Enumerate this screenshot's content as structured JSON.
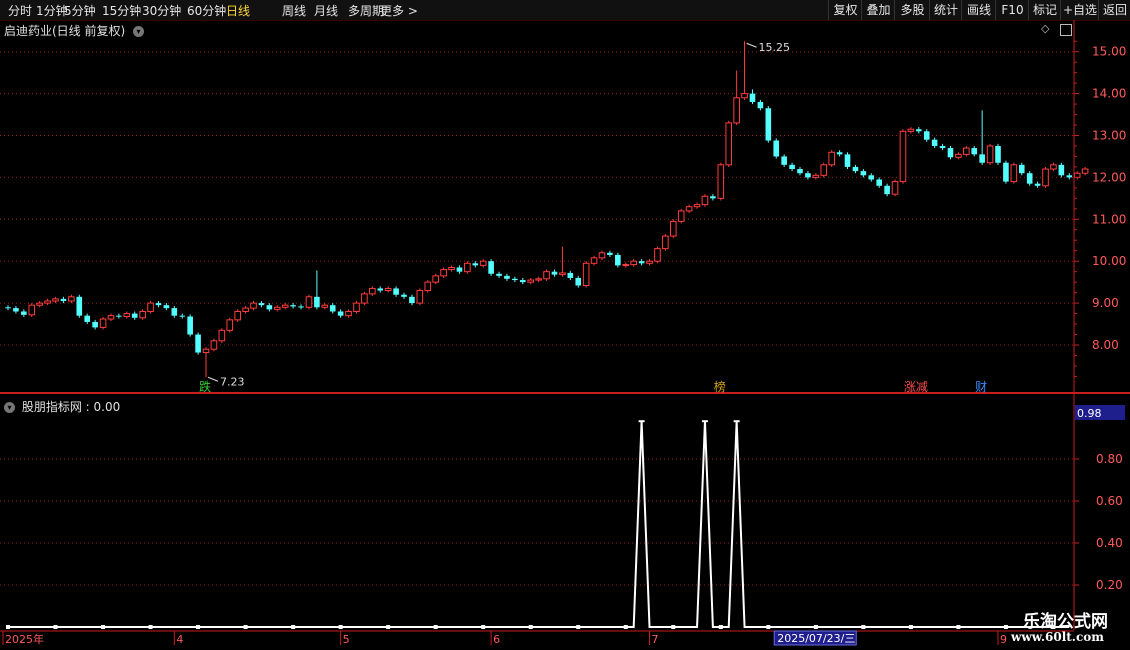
{
  "toolbar": {
    "left": [
      "分时",
      "1分钟",
      "5分钟",
      "15分钟",
      "30分钟",
      "60分钟",
      "日线",
      "周线",
      "月线",
      "多周期",
      "更多 >"
    ],
    "active": "日线",
    "right": [
      "复权",
      "叠加",
      "多股",
      "统计",
      "画线",
      "F10",
      "标记",
      "+自选",
      "返回"
    ]
  },
  "main_title": "启迪药业(日线 前复权)",
  "indicator_title": "股朋指标网 : 0.00",
  "markers": {
    "high": "15.25",
    "low": "7.23"
  },
  "events": [
    {
      "label": "跌",
      "color": "#33cc33",
      "date": "2025-04-08"
    },
    {
      "label": "榜",
      "color": "#d4a017",
      "date": "2025-07-14"
    },
    {
      "label": "涨减",
      "color": "#ff4d4d",
      "date": "2025-08-15"
    },
    {
      "label": "财",
      "color": "#3b8cff",
      "date": "2025-08-28"
    }
  ],
  "date_axis": {
    "labels": [
      {
        "date": "2025-03-03",
        "text": "2025年"
      },
      {
        "date": "2025-04-01",
        "text": "4"
      },
      {
        "date": "2025-05-06",
        "text": "5"
      },
      {
        "date": "2025-06-03",
        "text": "6"
      },
      {
        "date": "2025-07-01",
        "text": "7"
      },
      {
        "date": "2025-09-01",
        "text": "9"
      }
    ],
    "cursor_label": "2025/07/23/三"
  },
  "indicator_readout": "0.98",
  "watermark": {
    "text": "乐淘公式网",
    "url": "www.60lt.com"
  },
  "colors": {
    "up": "#ff3d3d",
    "down": "#54ffff",
    "grid": "#9a1e1e",
    "axis": "#c81e1e",
    "label": "#ff5a5a",
    "line": "#ffffff",
    "readout_bg": "#1e1e8c"
  },
  "chart_data": [
    {
      "type": "candlestick",
      "title": "启迪药业(日线 前复权)",
      "ylim": [
        7.0,
        15.3
      ],
      "yticks": [
        8.0,
        9.0,
        10.0,
        11.0,
        12.0,
        13.0,
        14.0,
        15.0
      ],
      "grid": true,
      "x": [
        "2025-03-03",
        "2025-03-04",
        "2025-03-05",
        "2025-03-06",
        "2025-03-07",
        "2025-03-10",
        "2025-03-11",
        "2025-03-12",
        "2025-03-13",
        "2025-03-14",
        "2025-03-17",
        "2025-03-18",
        "2025-03-19",
        "2025-03-20",
        "2025-03-21",
        "2025-03-24",
        "2025-03-25",
        "2025-03-26",
        "2025-03-27",
        "2025-03-28",
        "2025-03-31",
        "2025-04-01",
        "2025-04-02",
        "2025-04-03",
        "2025-04-07",
        "2025-04-08",
        "2025-04-09",
        "2025-04-10",
        "2025-04-11",
        "2025-04-14",
        "2025-04-15",
        "2025-04-16",
        "2025-04-17",
        "2025-04-18",
        "2025-04-21",
        "2025-04-22",
        "2025-04-23",
        "2025-04-24",
        "2025-04-25",
        "2025-04-28",
        "2025-04-29",
        "2025-04-30",
        "2025-05-06",
        "2025-05-07",
        "2025-05-08",
        "2025-05-09",
        "2025-05-12",
        "2025-05-13",
        "2025-05-14",
        "2025-05-15",
        "2025-05-16",
        "2025-05-19",
        "2025-05-20",
        "2025-05-21",
        "2025-05-22",
        "2025-05-23",
        "2025-05-26",
        "2025-05-27",
        "2025-05-28",
        "2025-05-29",
        "2025-05-30",
        "2025-06-03",
        "2025-06-04",
        "2025-06-05",
        "2025-06-06",
        "2025-06-09",
        "2025-06-10",
        "2025-06-11",
        "2025-06-12",
        "2025-06-13",
        "2025-06-16",
        "2025-06-17",
        "2025-06-18",
        "2025-06-19",
        "2025-06-20",
        "2025-06-23",
        "2025-06-24",
        "2025-06-25",
        "2025-06-26",
        "2025-06-27",
        "2025-06-30",
        "2025-07-01",
        "2025-07-02",
        "2025-07-03",
        "2025-07-04",
        "2025-07-07",
        "2025-07-08",
        "2025-07-09",
        "2025-07-10",
        "2025-07-11",
        "2025-07-14",
        "2025-07-15",
        "2025-07-16",
        "2025-07-17",
        "2025-07-18",
        "2025-07-21",
        "2025-07-22",
        "2025-07-23",
        "2025-07-24",
        "2025-07-25",
        "2025-07-28",
        "2025-07-29",
        "2025-07-30",
        "2025-07-31",
        "2025-08-01",
        "2025-08-04",
        "2025-08-05",
        "2025-08-06",
        "2025-08-07",
        "2025-08-08",
        "2025-08-11",
        "2025-08-12",
        "2025-08-13",
        "2025-08-14",
        "2025-08-15",
        "2025-08-18",
        "2025-08-19",
        "2025-08-20",
        "2025-08-21",
        "2025-08-22",
        "2025-08-25",
        "2025-08-26",
        "2025-08-27",
        "2025-08-28",
        "2025-08-29",
        "2025-09-01",
        "2025-09-02",
        "2025-09-03",
        "2025-09-04",
        "2025-09-05",
        "2025-09-08",
        "2025-09-09",
        "2025-09-10",
        "2025-09-11",
        "2025-09-12"
      ],
      "open": [
        8.9,
        8.88,
        8.8,
        8.72,
        8.95,
        9.0,
        9.05,
        9.1,
        9.05,
        9.15,
        8.7,
        8.55,
        8.42,
        8.62,
        8.7,
        8.68,
        8.75,
        8.65,
        8.8,
        9.0,
        8.95,
        8.88,
        8.7,
        8.68,
        8.25,
        7.82,
        7.9,
        8.1,
        8.35,
        8.6,
        8.8,
        8.88,
        9.0,
        8.95,
        8.85,
        8.9,
        8.95,
        8.92,
        8.9,
        9.15,
        8.9,
        8.95,
        8.8,
        8.7,
        8.8,
        9.0,
        9.22,
        9.35,
        9.3,
        9.35,
        9.2,
        9.15,
        9.0,
        9.3,
        9.5,
        9.65,
        9.8,
        9.85,
        9.75,
        9.95,
        9.9,
        10.0,
        9.7,
        9.65,
        9.58,
        9.55,
        9.5,
        9.55,
        9.58,
        9.75,
        9.68,
        9.72,
        9.6,
        9.42,
        9.95,
        10.08,
        10.2,
        10.15,
        9.9,
        9.92,
        10.0,
        9.95,
        10.0,
        10.3,
        10.6,
        10.95,
        11.2,
        11.3,
        11.35,
        11.55,
        11.5,
        12.3,
        13.3,
        13.9,
        14.0,
        13.8,
        13.65,
        12.88,
        12.5,
        12.3,
        12.2,
        12.1,
        12.0,
        12.05,
        12.3,
        12.6,
        12.55,
        12.25,
        12.15,
        12.05,
        11.95,
        11.8,
        11.6,
        11.9,
        13.1,
        13.15,
        13.1,
        12.9,
        12.75,
        12.7,
        12.48,
        12.55,
        12.7,
        12.55,
        12.35,
        12.75,
        12.35,
        11.9,
        12.3,
        12.1,
        11.85,
        11.8,
        12.2,
        12.3,
        12.05,
        12.0,
        12.1
      ]
    },
    {
      "type": "line",
      "title": "股朋指标网",
      "ylim": [
        0.0,
        1.0
      ],
      "yticks": [
        0.2,
        0.4,
        0.6,
        0.8
      ],
      "grid": true,
      "x": [
        "2025-03-03",
        "2025-06-27",
        "2025-06-30",
        "2025-07-01",
        "2025-07-09",
        "2025-07-10",
        "2025-07-11",
        "2025-07-15",
        "2025-07-16",
        "2025-07-17",
        "2025-09-12"
      ],
      "values": [
        0,
        0,
        0.98,
        0,
        0,
        0.98,
        0,
        0,
        0.98,
        0,
        0
      ]
    }
  ]
}
